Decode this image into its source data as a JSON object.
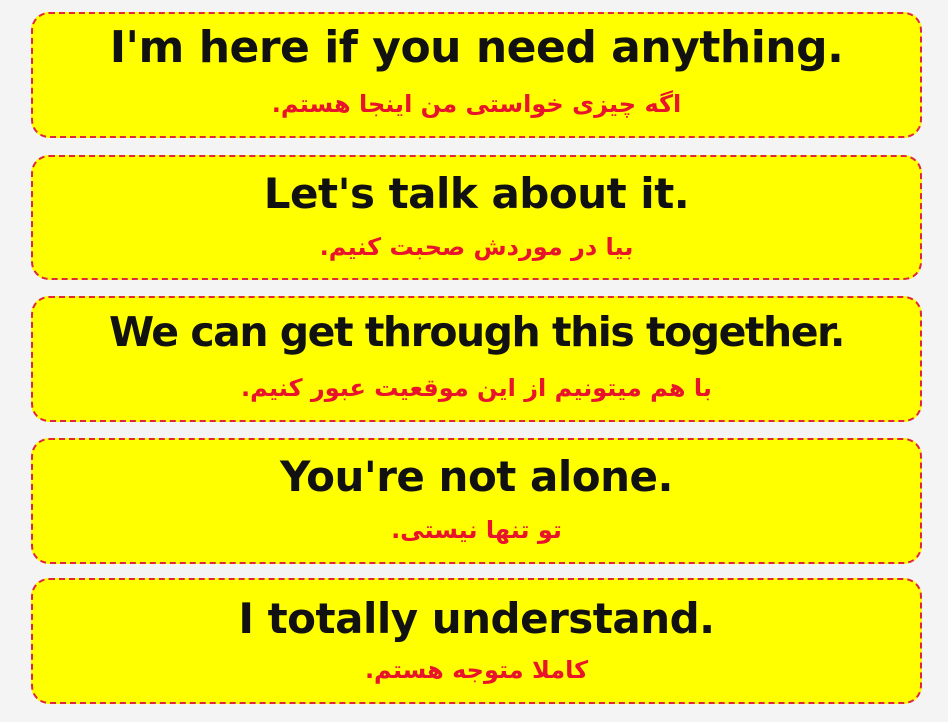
{
  "cards": [
    {
      "english": "I'm here if you need anything.",
      "persian": "اگه چیزی خواستی من اینجا هستم."
    },
    {
      "english": "Let's talk about it.",
      "persian": "بیا در موردش صحبت کنیم."
    },
    {
      "english": "We can get through this together.",
      "persian": "با هم میتونیم از این موقعیت عبور کنیم."
    },
    {
      "english": "You're not alone.",
      "persian": "تو تنها نیستی."
    },
    {
      "english": "I totally understand.",
      "persian": "کاملا متوجه هستم."
    }
  ],
  "colors": {
    "card_background": "#ffff00",
    "card_border": "#e0263c",
    "english_text": "#111111",
    "persian_text": "#e8142c",
    "page_background": "#f4f4f4"
  }
}
